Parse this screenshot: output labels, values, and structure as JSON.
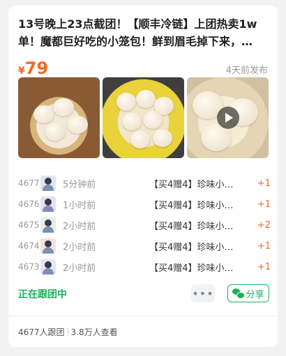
{
  "title": "13号晚上23点截团！【顺丰冷链】上团热卖1w单！魔都巨好吃的小笼包！鲜到眉毛掉下来，…",
  "price": {
    "symbol": "¥",
    "value": "79"
  },
  "posted": "4天前发布",
  "images": [
    {
      "name": "xiaolongbao-steamer-photo"
    },
    {
      "name": "xiaolongbao-yellow-plate-photo"
    },
    {
      "name": "xiaolongbao-video",
      "has_play_icon": true
    }
  ],
  "orders": [
    {
      "id": "4677",
      "time": "5分钟前",
      "item": "【买4赠4】珍味小…",
      "qty": "+1"
    },
    {
      "id": "4676",
      "time": "1小时前",
      "item": "【买4赠4】珍味小…",
      "qty": "+1"
    },
    {
      "id": "4675",
      "time": "2小时前",
      "item": "【买4赠4】珍味小…",
      "qty": "+2"
    },
    {
      "id": "4674",
      "time": "2小时前",
      "item": "【买4赠4】珍味小…",
      "qty": "+1"
    },
    {
      "id": "4673",
      "time": "2小时前",
      "item": "【买4赠4】珍味小…",
      "qty": "+1"
    }
  ],
  "status": "正在跟团中",
  "more_label": "•••",
  "share_label": "分享",
  "footer": {
    "joined": "4677人跟团",
    "views": "3.8万人查看"
  },
  "colors": {
    "accent": "#f26b1d",
    "green": "#18b35a"
  }
}
